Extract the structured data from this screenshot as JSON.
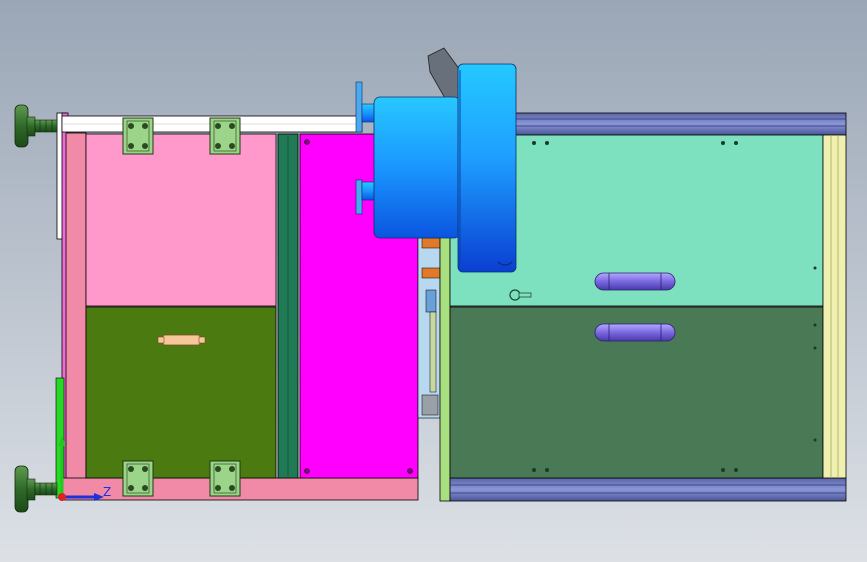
{
  "viewport": {
    "background_top": "#9aa6b6",
    "background_bottom": "#dde1e6"
  },
  "colors": {
    "foot": "#2f6a2a",
    "frame_pink": "#f08aa6",
    "frame_magenta": "#ff00ff",
    "panel_pink": "#ff99cc",
    "panel_olive": "#4a7a10",
    "panel_magenta": "#ff00ff",
    "strip_green": "#1f7a55",
    "bracket": "#9cd48a",
    "cylinder_blue": "#1e9fff",
    "cylinder_dark": "#0a44d6",
    "box_mint": "#7de0bf",
    "box_green": "#4a7a55",
    "rail_blue": "#7a86c8",
    "end_cap": "#f0f0b0",
    "capsule": "#8a7ae8",
    "handle": "#f5c79a"
  },
  "triad": {
    "axis_z_label": "Z"
  }
}
